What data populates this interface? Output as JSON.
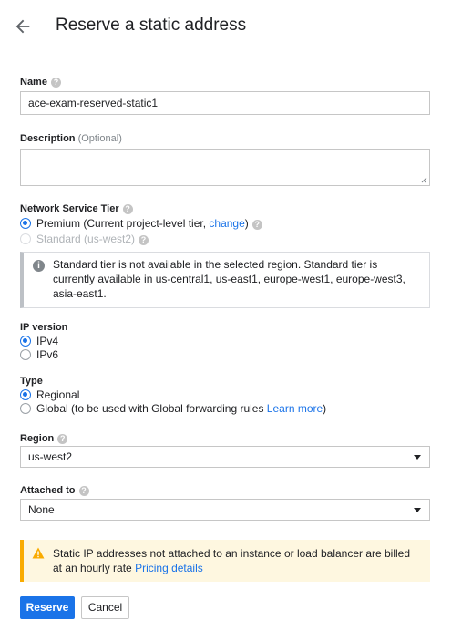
{
  "header": {
    "title": "Reserve a static address",
    "back_icon": "arrow-back-icon"
  },
  "name": {
    "label": "Name",
    "value": "ace-exam-reserved-static1",
    "help_icon": "help-icon"
  },
  "description": {
    "label": "Description",
    "optional": "(Optional)",
    "value": ""
  },
  "network_tier": {
    "label": "Network Service Tier",
    "premium": {
      "text": "Premium (Current project-level tier, ",
      "link": "change",
      "close": ")",
      "selected": true
    },
    "standard": {
      "text": "Standard (us-west2)",
      "selected": false,
      "disabled": true
    },
    "info": "Standard tier is not available in the selected region. Standard tier is currently available in us-central1, us-east1, europe-west1, europe-west3, asia-east1."
  },
  "ip_version": {
    "label": "IP version",
    "options": [
      {
        "text": "IPv4",
        "selected": true
      },
      {
        "text": "IPv6",
        "selected": false
      }
    ]
  },
  "type": {
    "label": "Type",
    "regional": {
      "text": "Regional",
      "selected": true
    },
    "global": {
      "text": "Global (to be used with Global forwarding rules ",
      "link": "Learn more",
      "close": ")",
      "selected": false
    }
  },
  "region": {
    "label": "Region",
    "value": "us-west2"
  },
  "attached_to": {
    "label": "Attached to",
    "value": "None"
  },
  "warning": {
    "text": "Static IP addresses not attached to an instance or load balancer are billed at an hourly rate ",
    "link": "Pricing details"
  },
  "actions": {
    "reserve": "Reserve",
    "cancel": "Cancel"
  },
  "colors": {
    "accent": "#1a73e8",
    "warning": "#f9ab00",
    "warning_bg": "#fef7e0"
  }
}
